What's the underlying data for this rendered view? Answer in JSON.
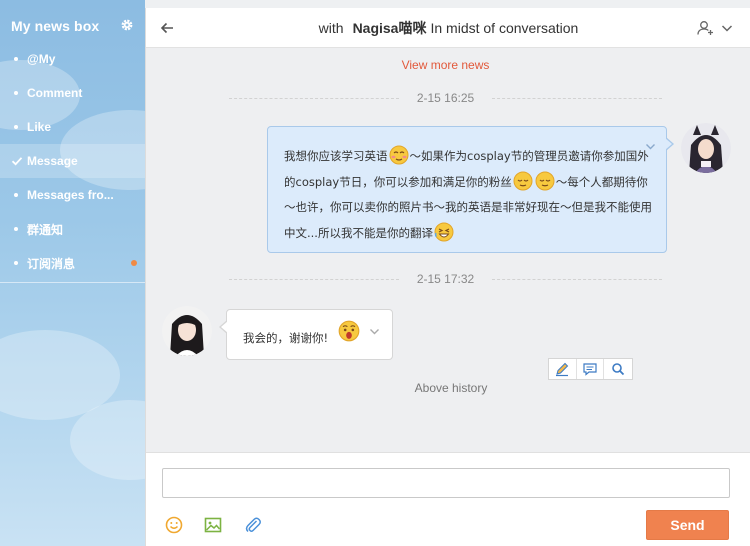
{
  "sidebar": {
    "title": "My news box",
    "items": [
      {
        "label": "@My",
        "icon": "bullet-icon"
      },
      {
        "label": "Comment",
        "icon": "bullet-icon"
      },
      {
        "label": "Like",
        "icon": "bullet-icon"
      },
      {
        "label": "Message",
        "icon": "check-icon",
        "active": true
      },
      {
        "label": "Messages fro...",
        "icon": "bullet-icon"
      },
      {
        "label": "群通知",
        "icon": "bullet-icon"
      },
      {
        "label": "订阅消息",
        "icon": "bullet-icon",
        "unread_dot": true
      }
    ]
  },
  "header": {
    "with_label": "with",
    "contact_name": "Nagisa喵咪",
    "status": "In midst of conversation"
  },
  "chat": {
    "view_more": "View more news",
    "timestamps": [
      "2-15 16:25",
      "2-15 17:32"
    ],
    "outgoing": {
      "segments": [
        "我想你应该学习英语",
        "～如果作为cosplay节的管理员邀请你参加国外的cosplay节日，你可以参加和满足你的粉丝",
        "～每个人都期待你～也许，你可以卖你的照片书～我的英语是非常好现在～但是我不能使用中文...所以我不能是你的翻译"
      ]
    },
    "incoming": {
      "text": "我会的，谢谢你!"
    },
    "above_history": "Above history"
  },
  "composer": {
    "input_value": "",
    "send_label": "Send"
  },
  "colors": {
    "accent": "#f0824f",
    "link": "#e2593b",
    "outgoing_bubble": "#dcebfb",
    "sidebar": "#9cc8e8"
  }
}
